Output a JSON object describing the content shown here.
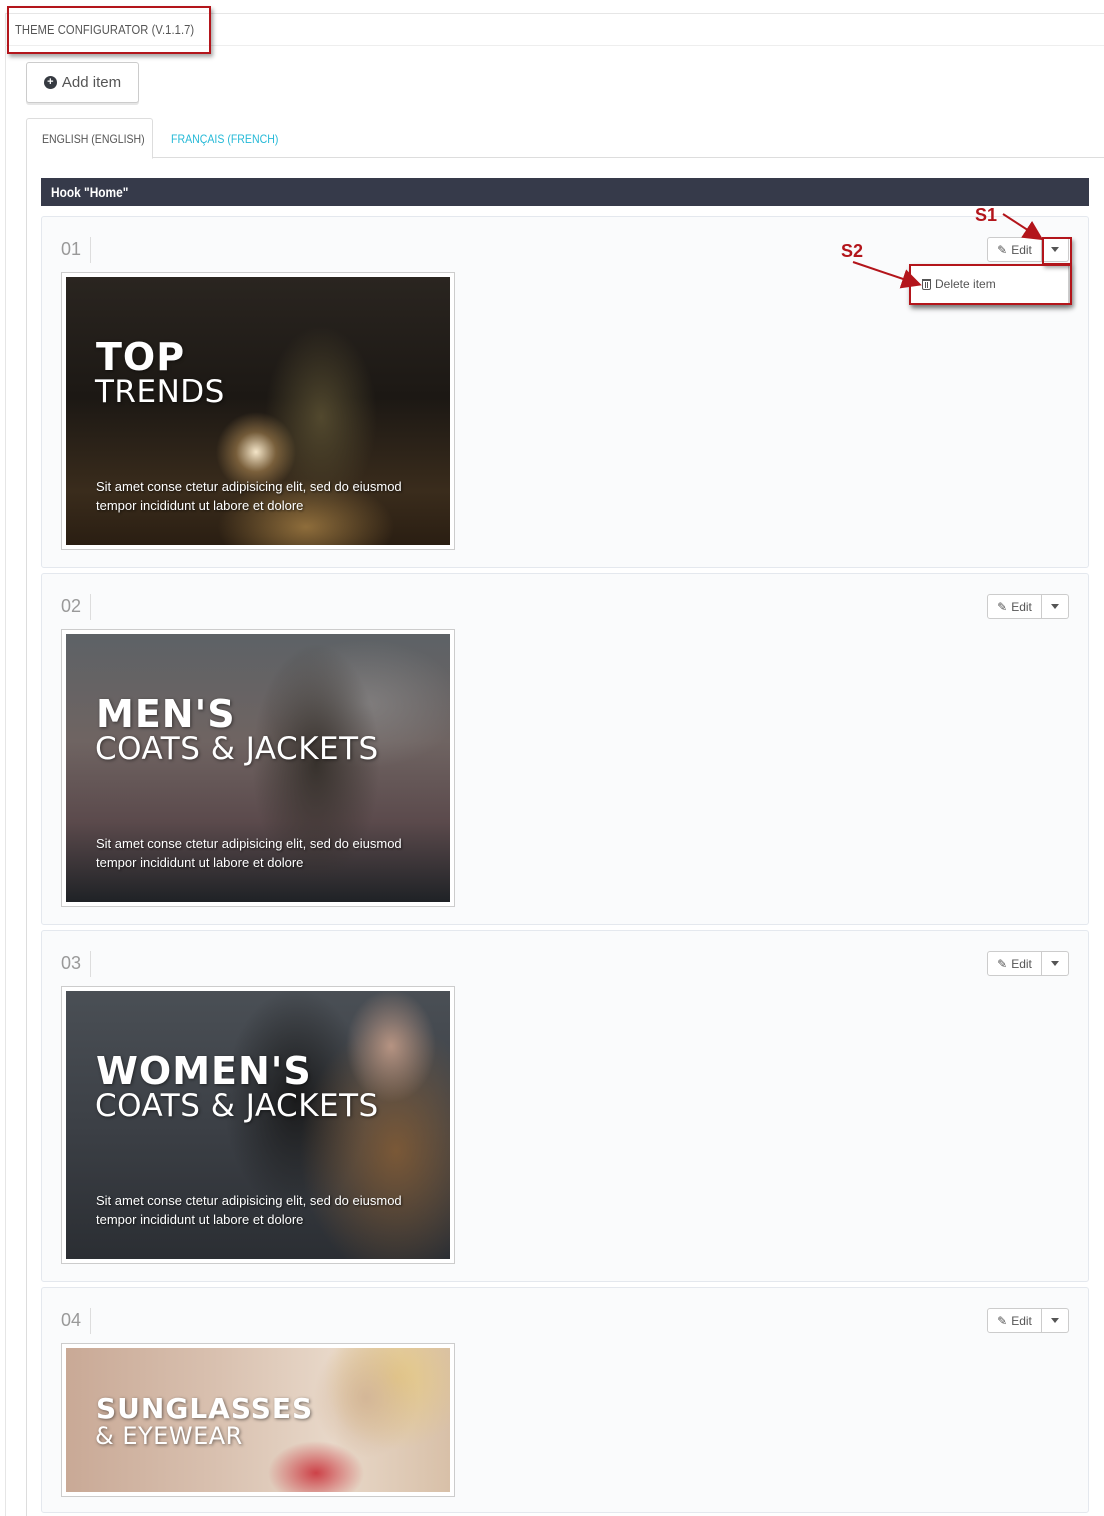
{
  "header": {
    "title": "THEME CONFIGURATOR (V.1.1.7)"
  },
  "toolbar": {
    "add_label": "Add item",
    "add_icon": "plus-circle-icon"
  },
  "tabs": [
    {
      "label": "ENGLISH (ENGLISH)",
      "active": true
    },
    {
      "label": "FRANÇAIS (FRENCH)",
      "active": false
    }
  ],
  "hook": {
    "label": "Hook \"Home\""
  },
  "items": [
    {
      "number": "01",
      "edit_label": "Edit",
      "heading": "TOP",
      "subheading": "TRENDS",
      "description": "Sit amet conse ctetur adipisicing elit, sed do eiusmod tempor incididunt ut labore et dolore"
    },
    {
      "number": "02",
      "edit_label": "Edit",
      "heading": "MEN'S",
      "subheading": "COATS & JACKETS",
      "description": "Sit amet conse ctetur adipisicing elit, sed do eiusmod tempor incididunt ut labore et dolore"
    },
    {
      "number": "03",
      "edit_label": "Edit",
      "heading": "WOMEN'S",
      "subheading": "COATS & JACKETS",
      "description": "Sit amet conse ctetur adipisicing elit, sed do eiusmod tempor incididunt ut labore et dolore"
    },
    {
      "number": "04",
      "edit_label": "Edit",
      "heading": "SUNGLASSES",
      "subheading": "& EYEWEAR",
      "description": ""
    }
  ],
  "dropdown": {
    "delete_label": "Delete item"
  },
  "annotations": {
    "s1": "S1",
    "s2": "S2",
    "color": "#b3151b"
  },
  "colors": {
    "accent": "#25b9d7",
    "hook_bar": "#363a4a"
  }
}
